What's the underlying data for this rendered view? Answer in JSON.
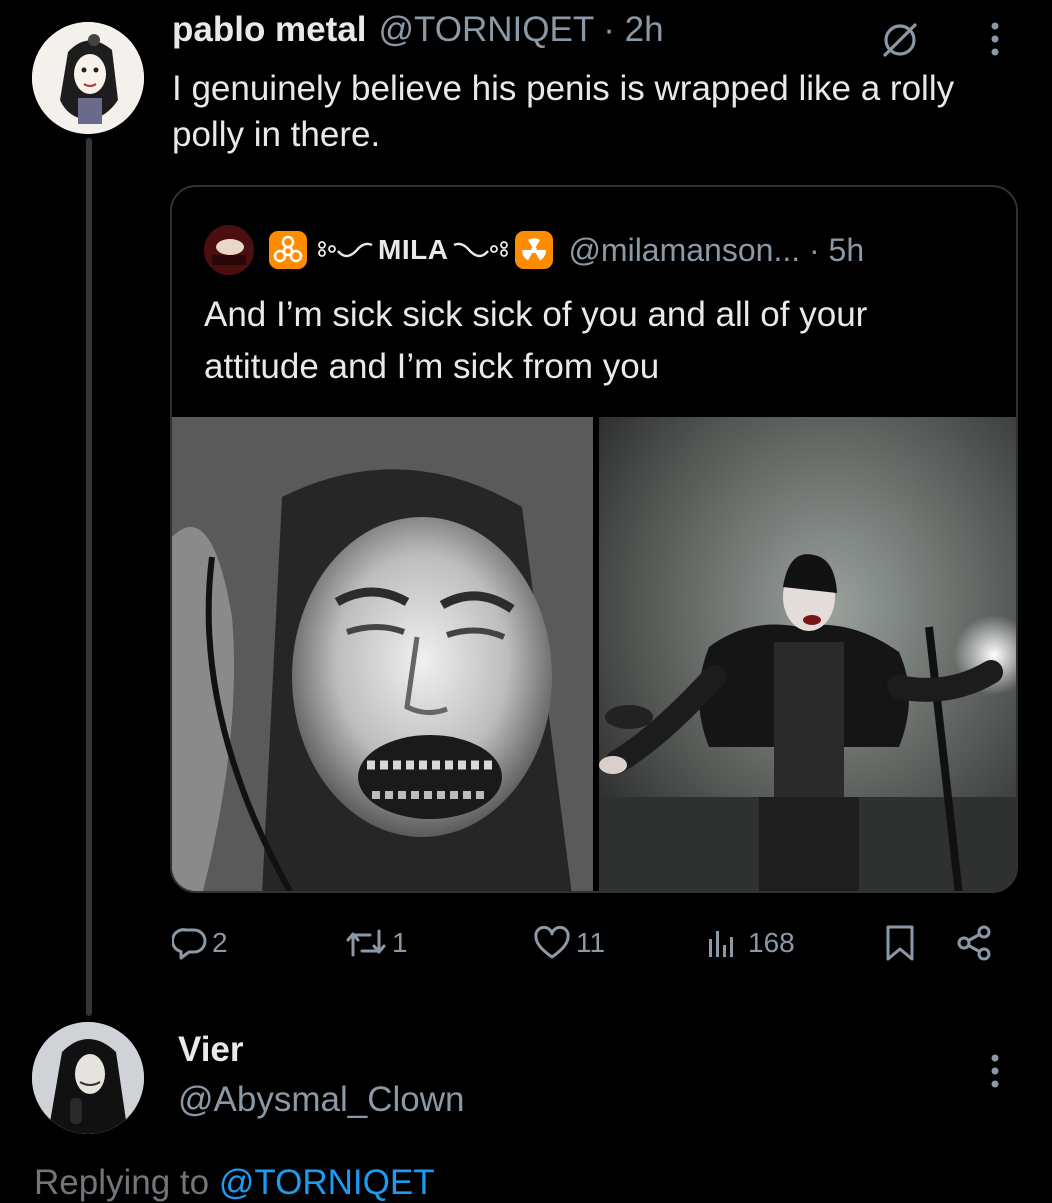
{
  "post": {
    "display_name": "pablo metal",
    "handle_time": "@TORNIQET · 2h",
    "text": "I genuinely believe his penis is wrapped like a rolly polly in there."
  },
  "quote": {
    "name": "MILA",
    "handle_time": "@milamanson... · 5h",
    "text": "And I’m sick sick sick of you and all of your attitude and I’m sick from you"
  },
  "actions": {
    "replies": "2",
    "reposts": "1",
    "likes": "11",
    "views": "168"
  },
  "reply": {
    "display_name": "Vier",
    "handle": "@Abysmal_Clown",
    "replying_prefix": "Replying to",
    "replying_handle": "@TORNIQET"
  },
  "colors": {
    "background": "#000000",
    "text": "#e7e9ea",
    "muted": "#8b98a5",
    "link": "#1d9bf0",
    "hazard_badge": "#ff8c00"
  }
}
